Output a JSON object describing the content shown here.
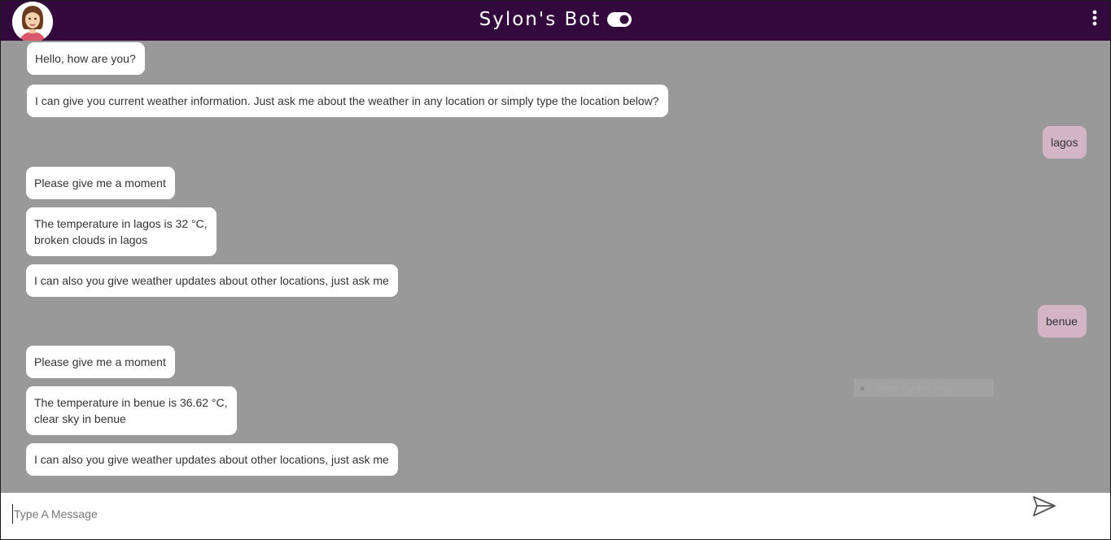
{
  "header": {
    "title": "Sylon's Bot",
    "background_color": "#33093d",
    "avatar_icon": "woman-avatar-icon",
    "toggle_icon": "toggle-icon",
    "menu_icon": "kebab-menu-icon"
  },
  "messages": [
    {
      "sender": "bot",
      "lines": [
        "Hello, how are you?"
      ]
    },
    {
      "sender": "bot",
      "lines": [
        "I can give you current weather information. Just ask me about the weather in any location or simply type the location below?"
      ]
    },
    {
      "sender": "user",
      "lines": [
        "lagos"
      ]
    },
    {
      "sender": "bot",
      "lines": [
        "Please give me a moment"
      ]
    },
    {
      "sender": "bot",
      "lines": [
        "The temperature in lagos is 32 °C,",
        "broken clouds in lagos"
      ]
    },
    {
      "sender": "bot",
      "lines": [
        "I can also you give weather updates about other locations, just ask me"
      ]
    },
    {
      "sender": "user",
      "lines": [
        "benue"
      ]
    },
    {
      "sender": "bot",
      "lines": [
        "Please give me a moment"
      ]
    },
    {
      "sender": "bot",
      "lines": [
        "The temperature in benue is 36.62 °C,",
        "clear sky in benue"
      ]
    },
    {
      "sender": "bot",
      "lines": [
        "I can also you give weather updates about other locations, just ask me"
      ]
    }
  ],
  "overlay": {
    "snip_label": "Rectangular Snip"
  },
  "composer": {
    "placeholder": "Type A Message",
    "value": "",
    "send_icon": "send-icon"
  },
  "colors": {
    "chat_background": "#999999",
    "bot_bubble": "#ffffff",
    "user_bubble": "#d4b5c6"
  }
}
